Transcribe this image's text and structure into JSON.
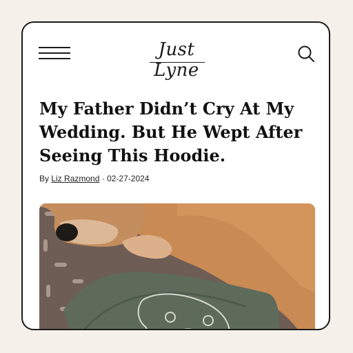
{
  "header": {
    "menu_icon": "hamburger-menu-icon",
    "logo_text": "Just Lyne",
    "search_icon": "search-icon"
  },
  "article": {
    "title": "My Father Didn’t Cry At My Wedding. But He Wept After Seeing This Hoodie.",
    "byline_prefix": "By",
    "author": "Liz Razmond",
    "separator": "·",
    "date": "02-27-2024"
  },
  "colors": {
    "background": "#f5f0ea",
    "card": "#ffffff",
    "text": "#111111"
  }
}
